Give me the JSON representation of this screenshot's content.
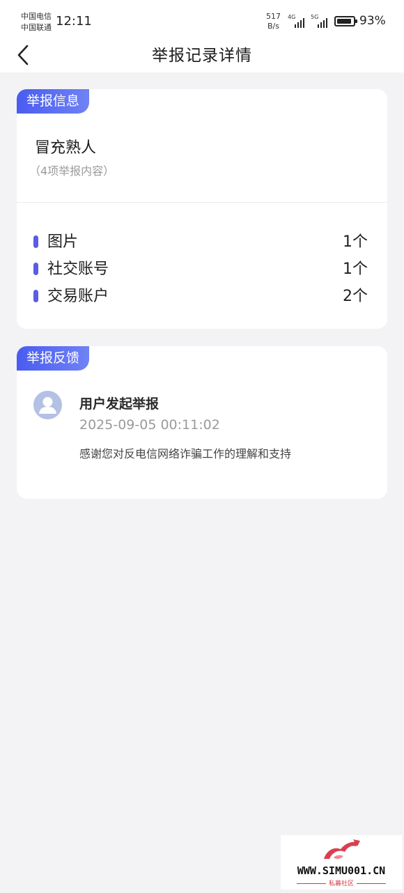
{
  "status_bar": {
    "carrier_1": "中国电信",
    "carrier_2": "中国联通",
    "time": "12:11",
    "net_speed_value": "517",
    "net_speed_unit": "B/s",
    "signal_1_gen": "4G",
    "signal_2_gen": "5G",
    "battery_level": 0.93,
    "battery_text": "93%"
  },
  "nav": {
    "title": "举报记录详情",
    "back_icon": "chevron-left-icon"
  },
  "report_info": {
    "tag": "举报信息",
    "category": "冒充熟人",
    "item_count_note": "（4项举报内容）",
    "accent_color": "#5a5ce6",
    "items": [
      {
        "label": "图片",
        "count": "1个"
      },
      {
        "label": "社交账号",
        "count": "1个"
      },
      {
        "label": "交易账户",
        "count": "2个"
      }
    ]
  },
  "report_feedback": {
    "tag": "举报反馈",
    "avatar_icon": "user-avatar-icon",
    "title": "用户发起举报",
    "time": "2025-09-05 00:11:02",
    "message": "感谢您对反电信网络诈骗工作的理解和支持"
  },
  "watermark": {
    "site": "WWW.SIMU001.CN",
    "name": "私募社区"
  }
}
